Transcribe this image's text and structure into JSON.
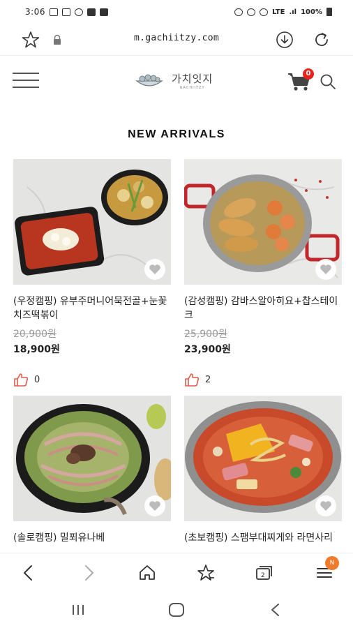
{
  "status_bar": {
    "time": "3:06",
    "battery": "100%",
    "network": "LTE"
  },
  "browser": {
    "url": "m.gachiitzy.com"
  },
  "site": {
    "logo_name": "가치잇지",
    "logo_sub": "GACHIITZY",
    "cart_count": "0"
  },
  "section": {
    "title": "NEW ARRIVALS"
  },
  "products": [
    {
      "name": "(우정캠핑) 유부주머니어묵전골+눈꽃치즈떡볶이",
      "original_price": "20,900원",
      "price": "18,900원",
      "likes": "0"
    },
    {
      "name": "(감성캠핑) 감바스알아히요+찹스테이크",
      "original_price": "25,900원",
      "price": "23,900원",
      "likes": "2"
    },
    {
      "name": "(솔로캠핑) 밀푀유나베"
    },
    {
      "name": "(초보캠핑) 스팸부대찌게와 라면사리"
    }
  ],
  "toolbar": {
    "tab_badge": "N"
  },
  "colors": {
    "badge_red": "#e8221b",
    "tab_orange": "#f07b2a",
    "like_red": "#e05a4b"
  }
}
